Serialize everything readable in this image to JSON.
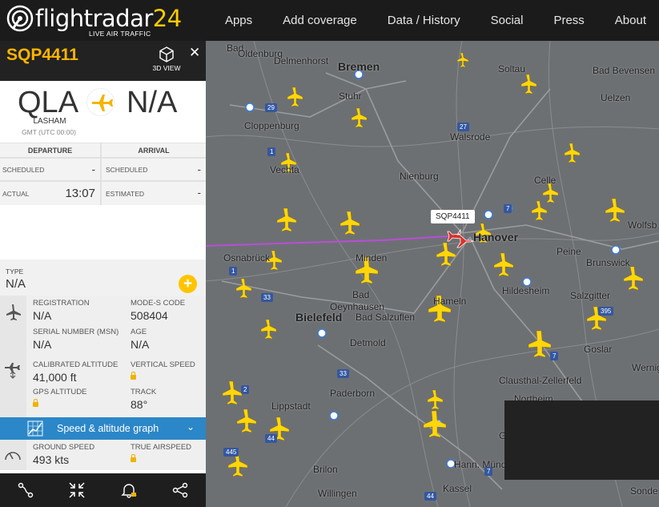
{
  "header": {
    "logo_word": "flightradar",
    "logo_num": "24",
    "logo_tagline": "LIVE AIR TRAFFIC",
    "nav": [
      "Apps",
      "Add coverage",
      "Data / History",
      "Social",
      "Press",
      "About"
    ]
  },
  "panel": {
    "callsign": "SQP4411",
    "view3d_label": "3D VIEW",
    "origin": {
      "code": "QLA",
      "city": "LASHAM",
      "timezone": "GMT (UTC 00:00)"
    },
    "destination": {
      "code": "N/A"
    },
    "times": {
      "departure_head": "DEPARTURE",
      "arrival_head": "ARRIVAL",
      "scheduled_label": "SCHEDULED",
      "scheduled_dep": "-",
      "scheduled_arr": "-",
      "actual_label": "ACTUAL",
      "actual_dep": "13:07",
      "estimated_label": "ESTIMATED",
      "estimated_arr": "-"
    },
    "type": {
      "label": "TYPE",
      "value": "N/A"
    },
    "details": {
      "registration_label": "REGISTRATION",
      "registration": "N/A",
      "modes_label": "MODE-S CODE",
      "modes": "508404",
      "serial_label": "SERIAL NUMBER (MSN)",
      "serial": "N/A",
      "age_label": "AGE",
      "age": "N/A",
      "cal_alt_label": "CALIBRATED ALTITUDE",
      "cal_alt": "41,000 ft",
      "vspeed_label": "VERTICAL SPEED",
      "gps_alt_label": "GPS ALTITUDE",
      "track_label": "TRACK",
      "track": "88°"
    },
    "graph_label": "Speed & altitude graph",
    "speeds": {
      "ground_label": "GROUND SPEED",
      "ground": "493 kts",
      "true_label": "TRUE AIRSPEED"
    }
  },
  "map": {
    "selected_label": "SQP4411",
    "cities": [
      {
        "name": "Bad",
        "cls": ""
      },
      {
        "name": "Oldenburg",
        "cls": ""
      },
      {
        "name": "Bremen",
        "cls": "big"
      },
      {
        "name": "Delmenhorst",
        "cls": ""
      },
      {
        "name": "Stuhr",
        "cls": ""
      },
      {
        "name": "Soltau",
        "cls": ""
      },
      {
        "name": "Bad Bevensen",
        "cls": ""
      },
      {
        "name": "Uelzen",
        "cls": ""
      },
      {
        "name": "Cloppenburg",
        "cls": ""
      },
      {
        "name": "Walsrode",
        "cls": ""
      },
      {
        "name": "Vechta",
        "cls": ""
      },
      {
        "name": "Nienburg",
        "cls": ""
      },
      {
        "name": "Celle",
        "cls": ""
      },
      {
        "name": "Hanover",
        "cls": "big"
      },
      {
        "name": "Wolfsb",
        "cls": ""
      },
      {
        "name": "Osnabrück",
        "cls": ""
      },
      {
        "name": "Minden",
        "cls": ""
      },
      {
        "name": "Peine",
        "cls": ""
      },
      {
        "name": "Brunswick",
        "cls": ""
      },
      {
        "name": "Hildesheim",
        "cls": ""
      },
      {
        "name": "Bad",
        "cls": ""
      },
      {
        "name": "Oeynhausen",
        "cls": ""
      },
      {
        "name": "Salzgitter",
        "cls": ""
      },
      {
        "name": "Bielefeld",
        "cls": "big"
      },
      {
        "name": "Bad Salzuflen",
        "cls": ""
      },
      {
        "name": "Hameln",
        "cls": ""
      },
      {
        "name": "Detmold",
        "cls": ""
      },
      {
        "name": "Goslar",
        "cls": ""
      },
      {
        "name": "Werniger",
        "cls": ""
      },
      {
        "name": "Clausthal-Zellerfeld",
        "cls": ""
      },
      {
        "name": "Paderborn",
        "cls": ""
      },
      {
        "name": "Northeim",
        "cls": ""
      },
      {
        "name": "Lippstadt",
        "cls": ""
      },
      {
        "name": "Brilon",
        "cls": ""
      },
      {
        "name": "Hann. Münden",
        "cls": ""
      },
      {
        "name": "Kassel",
        "cls": ""
      },
      {
        "name": "Willingen",
        "cls": ""
      },
      {
        "name": "Sonder",
        "cls": ""
      },
      {
        "name": "Gö",
        "cls": ""
      }
    ],
    "roads": [
      "29",
      "1",
      "27",
      "7",
      "1",
      "33",
      "2",
      "33",
      "7",
      "395",
      "445",
      "44",
      "7",
      "44"
    ]
  }
}
